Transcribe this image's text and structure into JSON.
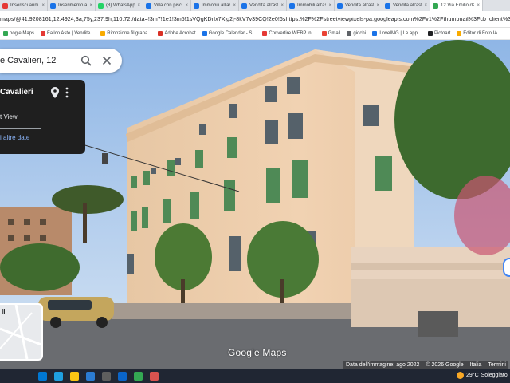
{
  "browser": {
    "tabs": [
      {
        "label": "Inserisci annunci",
        "color": "#e53935",
        "active": false
      },
      {
        "label": "Inserimento annu",
        "color": "#1a73e8",
        "active": false
      },
      {
        "label": "(8) WhatsApp",
        "color": "#25d366",
        "active": false
      },
      {
        "label": "Villa con piscina",
        "color": "#1a73e8",
        "active": false
      },
      {
        "label": "Immobili all'asta",
        "color": "#1a73e8",
        "active": false
      },
      {
        "label": "Vendita all'asta A",
        "color": "#1a73e8",
        "active": false
      },
      {
        "label": "Immobili all'asta",
        "color": "#1a73e8",
        "active": false
      },
      {
        "label": "Vendita all'asta A",
        "color": "#1a73e8",
        "active": false
      },
      {
        "label": "Vendita all'asta A",
        "color": "#1a73e8",
        "active": false
      },
      {
        "label": "12 Via Emilio de",
        "color": "#34a853",
        "active": true
      }
    ],
    "url": "maps/@41.9208161,12.4924,3a,75y,237.9h,110.72t/data=!3m7!1e1!3m5!1sVQgKDrIx7Xlg2j-8kV7v39CQ!2e0!6shttps:%2F%2Fstreetviewpixels-pa.googleapis.com%2Fv1%2Fthumbnail%3Fcb_client%3Dmaps_sv.tactile%26w%3D900%2",
    "bookmarks": [
      {
        "label": "oogle Maps",
        "color": "#34a853"
      },
      {
        "label": "Fallco Aste | Vendite...",
        "color": "#e53935"
      },
      {
        "label": "Rimozione filigrana...",
        "color": "#f9ab00"
      },
      {
        "label": "Adobe Acrobat",
        "color": "#d93025"
      },
      {
        "label": "Google Calendar - S...",
        "color": "#1a73e8"
      },
      {
        "label": "Convertire WEBP in...",
        "color": "#e53935"
      },
      {
        "label": "Gmail",
        "color": "#ea4335"
      },
      {
        "label": "giochi",
        "color": "#5f6368"
      },
      {
        "label": "iLoveIMG | Le app...",
        "color": "#1a73e8"
      },
      {
        "label": "Pictoart",
        "color": "#202124"
      },
      {
        "label": "Editor di Foto IA",
        "color": "#f9ab00"
      }
    ]
  },
  "maps": {
    "search_value": "e Cavalieri, 12",
    "info_title": "Cavalieri",
    "info_subtitle": "t View",
    "info_link": "i altre date",
    "logo_text": "Google Maps",
    "pause_glyph": "II",
    "attribution": {
      "image_date": "Data dell'immagine: ago 2022",
      "copyright": "© 2026 Google",
      "country": "Italia",
      "terms": "Termini"
    }
  },
  "taskbar": {
    "weather_temp": "29°C",
    "weather_desc": "Soleggiato",
    "apps": [
      {
        "name": "start",
        "color": "#0078d4"
      },
      {
        "name": "edge",
        "color": "#1fa0e0"
      },
      {
        "name": "explorer",
        "color": "#f9c513"
      },
      {
        "name": "word",
        "color": "#2b7cd3"
      },
      {
        "name": "store",
        "color": "#5e5e5e"
      },
      {
        "name": "mail",
        "color": "#0a64c8"
      },
      {
        "name": "chrome",
        "color": "#34a853"
      },
      {
        "name": "photos",
        "color": "#d9534f"
      }
    ]
  }
}
